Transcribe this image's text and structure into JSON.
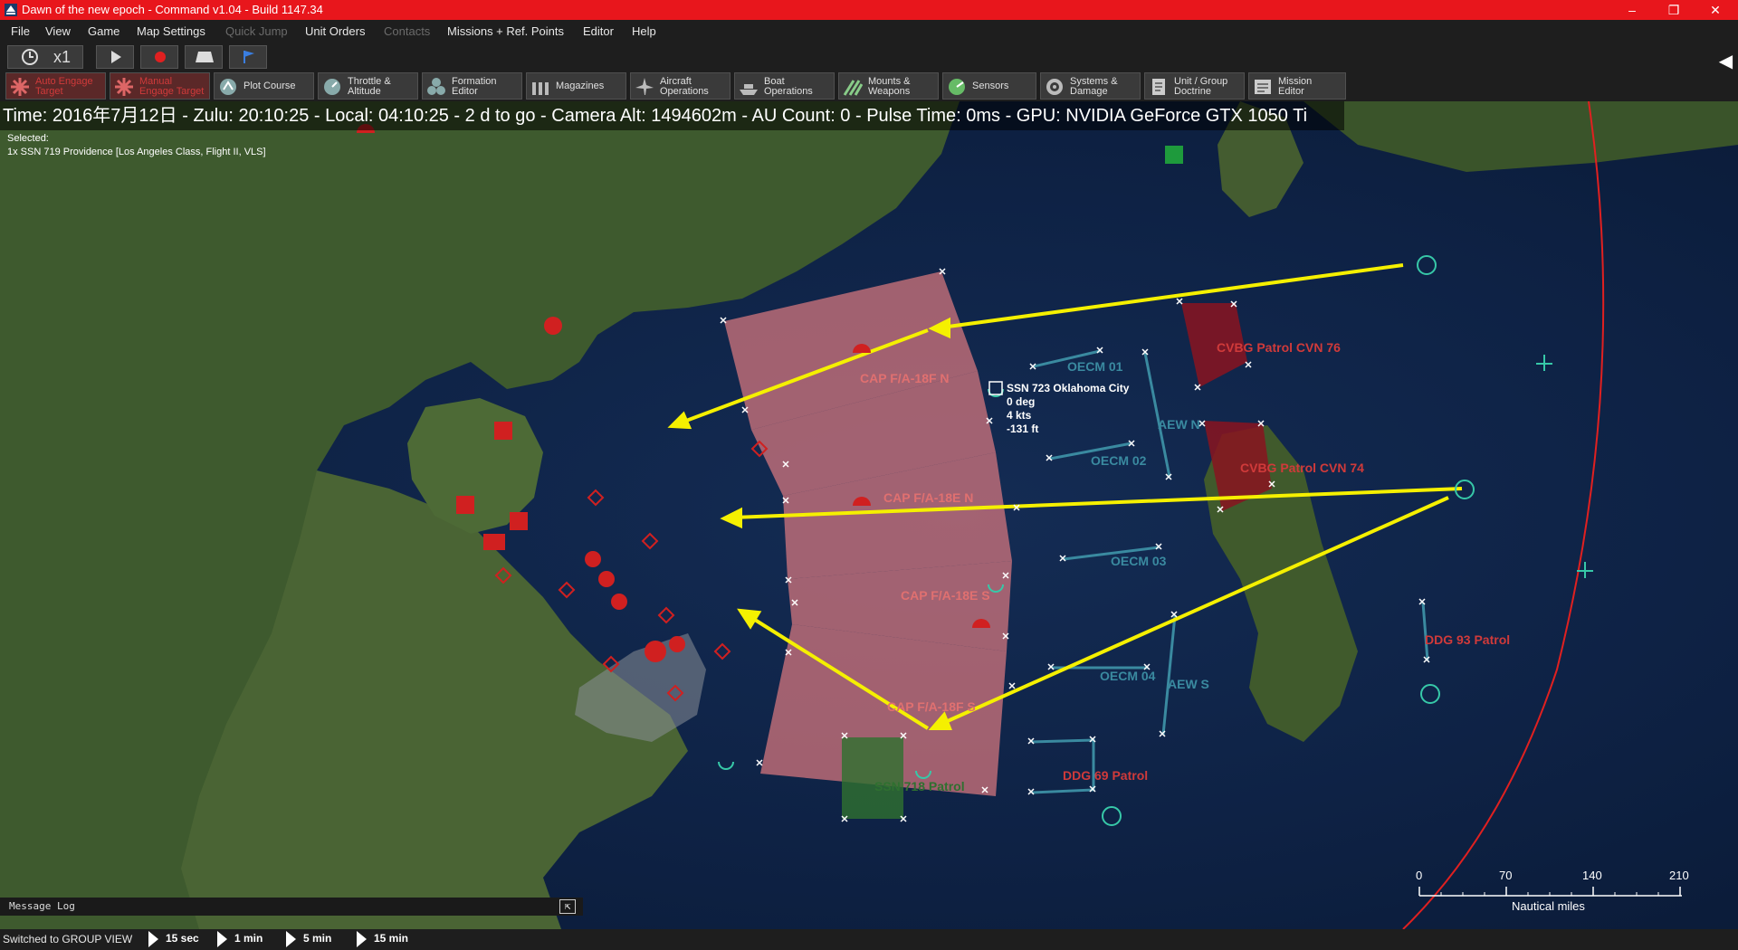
{
  "window": {
    "title": "Dawn of the new epoch - Command v1.04 - Build 1147.34",
    "minimize": "–",
    "restore": "❐",
    "close": "✕"
  },
  "menu": [
    "File",
    "View",
    "Game",
    "Map Settings",
    "Quick Jump",
    "Unit Orders",
    "Contacts",
    "Missions + Ref. Points",
    "Editor",
    "Help"
  ],
  "menu_disabled": [
    "Quick Jump",
    "Contacts"
  ],
  "time_controls": {
    "compression": "x1"
  },
  "toolbar": [
    {
      "label": "Auto Engage\nTarget",
      "icon": "auto-engage-icon"
    },
    {
      "label": "Manual\nEngage Target",
      "icon": "manual-engage-icon"
    },
    {
      "label": "Plot Course",
      "icon": "plot-course-icon"
    },
    {
      "label": "Throttle &\nAltitude",
      "icon": "throttle-icon"
    },
    {
      "label": "Formation\nEditor",
      "icon": "formation-icon"
    },
    {
      "label": "Magazines",
      "icon": "magazines-icon"
    },
    {
      "label": "Aircraft\nOperations",
      "icon": "aircraft-icon"
    },
    {
      "label": "Boat\nOperations",
      "icon": "boat-icon"
    },
    {
      "label": "Mounts &\nWeapons",
      "icon": "weapons-icon"
    },
    {
      "label": "Sensors",
      "icon": "sensors-icon"
    },
    {
      "label": "Systems &\nDamage",
      "icon": "systems-icon"
    },
    {
      "label": "Unit / Group\nDoctrine",
      "icon": "doctrine-icon"
    },
    {
      "label": "Mission\nEditor",
      "icon": "mission-editor-icon"
    }
  ],
  "status_line": "Time: 2016年7月12日 - Zulu: 20:10:25 - Local: 04:10:25 - 2 d to go -  Camera Alt: 1494602m  - AU Count: 0 - Pulse Time: 0ms - GPU: NVIDIA GeForce GTX 1050 Ti",
  "selected": {
    "label": "Selected:",
    "unit": "1x SSN 719 Providence [Los Angeles Class, Flight II, VLS]"
  },
  "map_labels": {
    "cap_n": "CAP F/A-18F N",
    "cap_e_n": "CAP F/A-18E N",
    "cap_e_s": "CAP F/A-18E S",
    "cap_f_s": "CAP F/A-18F S",
    "cvbg_76": "CVBG Patrol CVN 76",
    "cvbg_74": "CVBG Patrol CVN 74",
    "oecm_01": "OECM 01",
    "oecm_02": "OECM 02",
    "oecm_03": "OECM 03",
    "oecm_04": "OECM 04",
    "aew_n": "AEW N",
    "aew_s": "AEW S",
    "ddg_93": "DDG 93 Patrol",
    "ddg_69": "DDG 69 Patrol",
    "ssn_patrol": "SSN 718 Patrol"
  },
  "unit_info": {
    "name": "SSN 723 Oklahoma City",
    "heading": "0 deg",
    "speed": "4 kts",
    "depth": "-131 ft"
  },
  "scale": {
    "ticks": [
      "0",
      "70",
      "140",
      "210"
    ],
    "unit": "Nautical miles"
  },
  "message_log": {
    "label": "Message Log",
    "expand_icon": "⇱"
  },
  "bottom": {
    "group_view": "Switched to GROUP VIEW",
    "time_steps": [
      "15 sec",
      "1 min",
      "5 min",
      "15 min"
    ]
  },
  "colors": {
    "title_bar": "#e8161c",
    "hostile": "#d02020",
    "friendly": "#37c8a8",
    "patrol_zone": "#e07a80",
    "teal_lines": "#3a8aa0",
    "attack_arrow": "#f5f000"
  }
}
